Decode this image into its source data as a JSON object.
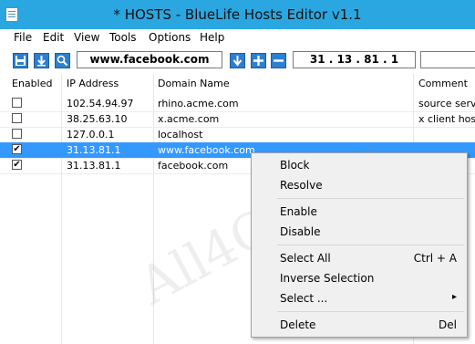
{
  "window": {
    "title": "* HOSTS - BlueLife Hosts Editor v1.1"
  },
  "menu": [
    "File",
    "Edit",
    "View",
    "Tools",
    "Options",
    "Help"
  ],
  "toolbar": {
    "domain_value": "www.facebook.com",
    "ip_value": "31 . 13 . 81 . 1",
    "buttons": [
      "save-icon",
      "download-icon",
      "search-icon",
      "down-arrow-icon",
      "add-icon",
      "remove-icon"
    ]
  },
  "table": {
    "headers": [
      "Enabled",
      "IP Address",
      "Domain Name",
      "Comment"
    ],
    "rows": [
      {
        "enabled": false,
        "ip": "102.54.94.97",
        "domain": "rhino.acme.com",
        "comment": "source serve",
        "selected": false
      },
      {
        "enabled": false,
        "ip": "38.25.63.10",
        "domain": "x.acme.com",
        "comment": "x client host",
        "selected": false
      },
      {
        "enabled": false,
        "ip": "127.0.0.1",
        "domain": "localhost",
        "comment": "",
        "selected": false
      },
      {
        "enabled": true,
        "ip": "31.13.81.1",
        "domain": "www.facebook.com",
        "comment": "",
        "selected": true
      },
      {
        "enabled": true,
        "ip": "31.13.81.1",
        "domain": "facebook.com",
        "comment": "",
        "selected": false
      }
    ]
  },
  "context_menu": {
    "items": [
      {
        "label": "Block",
        "shortcut": ""
      },
      {
        "label": "Resolve",
        "shortcut": ""
      },
      {
        "label": "Enable",
        "shortcut": ""
      },
      {
        "label": "Disable",
        "shortcut": ""
      },
      {
        "label": "Select All",
        "shortcut": "Ctrl + A"
      },
      {
        "label": "Inverse Selection",
        "shortcut": ""
      },
      {
        "label": "Select ...",
        "shortcut": "▸"
      },
      {
        "label": "Delete",
        "shortcut": "Del"
      }
    ]
  },
  "watermark": "All4OS.RU",
  "colors": {
    "titlebar": "#2aa7e1",
    "selection": "#3399ff",
    "toolbar_button": "#2d7fd0"
  }
}
